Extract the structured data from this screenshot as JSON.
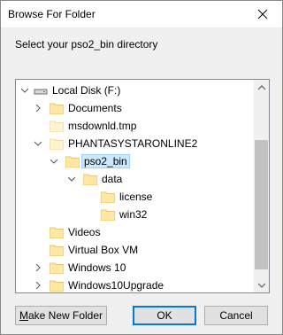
{
  "window": {
    "title": "Browse For Folder",
    "instruction": "Select your pso2_bin directory"
  },
  "tree": {
    "items": [
      {
        "label": "Local Disk (F:)",
        "icon": "drive-icon",
        "expander": "expanded"
      },
      {
        "label": "Documents",
        "icon": "folder-icon",
        "expander": "collapsed"
      },
      {
        "label": "msdownld.tmp",
        "icon": "folder-icon",
        "expander": "none"
      },
      {
        "label": "PHANTASYSTARONLINE2",
        "icon": "folder-icon",
        "expander": "expanded"
      },
      {
        "label": "pso2_bin",
        "icon": "folder-icon",
        "expander": "expanded",
        "selected": true
      },
      {
        "label": "data",
        "icon": "folder-icon",
        "expander": "expanded"
      },
      {
        "label": "license",
        "icon": "folder-icon",
        "expander": "none"
      },
      {
        "label": "win32",
        "icon": "folder-icon",
        "expander": "none"
      },
      {
        "label": "Videos",
        "icon": "folder-icon",
        "expander": "none"
      },
      {
        "label": "Virtual Box VM",
        "icon": "folder-icon",
        "expander": "none"
      },
      {
        "label": "Windows 10",
        "icon": "folder-icon",
        "expander": "collapsed"
      },
      {
        "label": "Windows10Upgrade",
        "icon": "folder-icon",
        "expander": "collapsed"
      }
    ]
  },
  "buttons": {
    "make_new_folder_prefix": "M",
    "make_new_folder_rest": "ake New Folder",
    "ok": "OK",
    "cancel": "Cancel"
  },
  "colors": {
    "selection_fill": "#cce8ff",
    "selection_border": "#99d1ff",
    "folder": "#ffe8a6",
    "default_button_border": "#0078d7"
  }
}
